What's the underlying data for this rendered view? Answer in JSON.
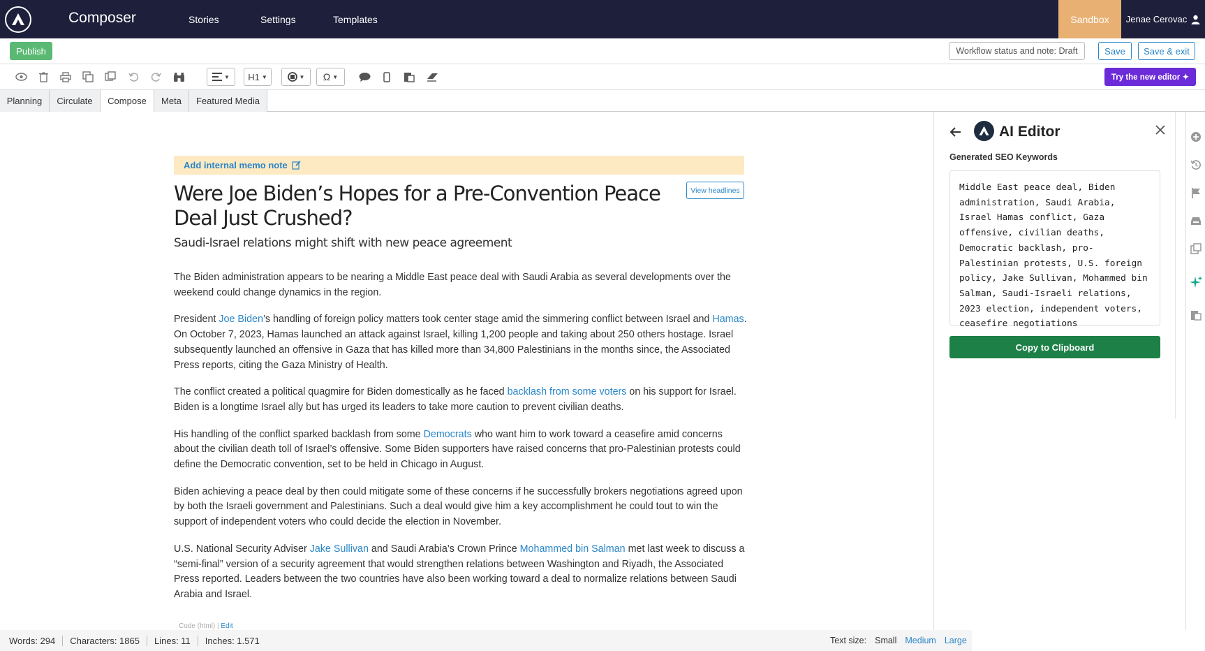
{
  "topbar": {
    "app_title": "Composer",
    "nav": [
      {
        "label": "Stories"
      },
      {
        "label": "Settings"
      },
      {
        "label": "Templates"
      }
    ],
    "sandbox": "Sandbox",
    "user": "Jenae Cerovac"
  },
  "actionbar": {
    "publish": "Publish",
    "workflow": "Workflow status and note: Draft",
    "save": "Save",
    "save_exit": "Save & exit"
  },
  "toolbar": {
    "heading_select": "H1",
    "new_editor": "Try the new editor"
  },
  "tabs": [
    {
      "label": "Planning"
    },
    {
      "label": "Circulate"
    },
    {
      "label": "Compose"
    },
    {
      "label": "Meta"
    },
    {
      "label": "Featured Media"
    }
  ],
  "article": {
    "memo": "Add internal memo note",
    "view_headlines": "View headlines",
    "headline": "Were Joe Biden’s Hopes for a Pre-Convention Peace Deal Just Crushed?",
    "subtitle": "Saudi-Israel relations might shift with new peace agreement",
    "p1": "The Biden administration appears to be nearing a Middle East peace deal with Saudi Arabia as several developments over the weekend could change dynamics in the region.",
    "p2_a": "President ",
    "p2_link1": "Joe Biden",
    "p2_b": "’s handling of foreign policy matters took center stage amid the simmering conflict between Israel and ",
    "p2_link2": "Hamas",
    "p2_c": ". On October 7, 2023, Hamas launched an attack against Israel, killing 1,200 people and taking about 250 others hostage. Israel subsequently launched an offensive in Gaza that has killed more than 34,800 Palestinians in the months since, the Associated Press reports, citing the Gaza Ministry of Health.",
    "p3_a": "The conflict created a political quagmire for Biden domestically as he faced ",
    "p3_link": "backlash from some voters",
    "p3_b": " on his support for Israel. Biden is a longtime Israel ally but has urged its leaders to take more caution to prevent civilian deaths.",
    "p4_a": "His handling of the conflict sparked backlash from some ",
    "p4_link": "Democrats",
    "p4_b": " who want him to work toward a ceasefire amid concerns about the civilian death toll of Israel’s offensive. Some Biden supporters have raised concerns that pro-Palestinian protests could define the Democratic convention, set to be held in Chicago in August.",
    "p5": "Biden achieving a peace deal by then could mitigate some of these concerns if he successfully brokers negotiations agreed upon by both the Israeli government and Palestinians. Such a deal would give him a key accomplishment he could tout to win the support of independent voters who could decide the election in November.",
    "p6_a": "U.S. National Security Adviser ",
    "p6_link1": "Jake Sullivan",
    "p6_b": " and Saudi Arabia’s Crown Prince ",
    "p6_link2": "Mohammed bin Salman",
    "p6_c": " met last week to discuss a “semi-final” version of a security agreement that would strengthen relations between Washington and Riyadh, the Associated Press reported. Leaders between the two countries have also been working toward a deal to normalize relations between Saudi Arabia and Israel.",
    "code_label": "Code (html) | ",
    "code_edit": "Edit"
  },
  "status": {
    "words": "Words: 294",
    "characters": "Characters: 1865",
    "lines": "Lines: 11",
    "inches": "Inches: 1.571",
    "text_size_label": "Text size:",
    "small": "Small",
    "medium": "Medium",
    "large": "Large"
  },
  "ai_editor": {
    "title": "AI Editor",
    "label": "Generated SEO Keywords",
    "keywords": "Middle East peace deal, Biden administration, Saudi Arabia, Israel Hamas conflict, Gaza offensive, civilian deaths, Democratic backlash, pro-Palestinian protests, U.S. foreign policy, Jake Sullivan, Mohammed bin Salman, Saudi-Israeli relations, 2023 election, independent voters, ceasefire negotiations",
    "copy": "Copy to Clipboard"
  },
  "colors": {
    "topbar": "#1d1f3b",
    "sandbox": "#e8b072",
    "publish": "#5bb974",
    "link": "#2a86c9",
    "new_editor": "#6b2bd9",
    "copy": "#1d8047",
    "memo_bg": "#fde9c2"
  }
}
